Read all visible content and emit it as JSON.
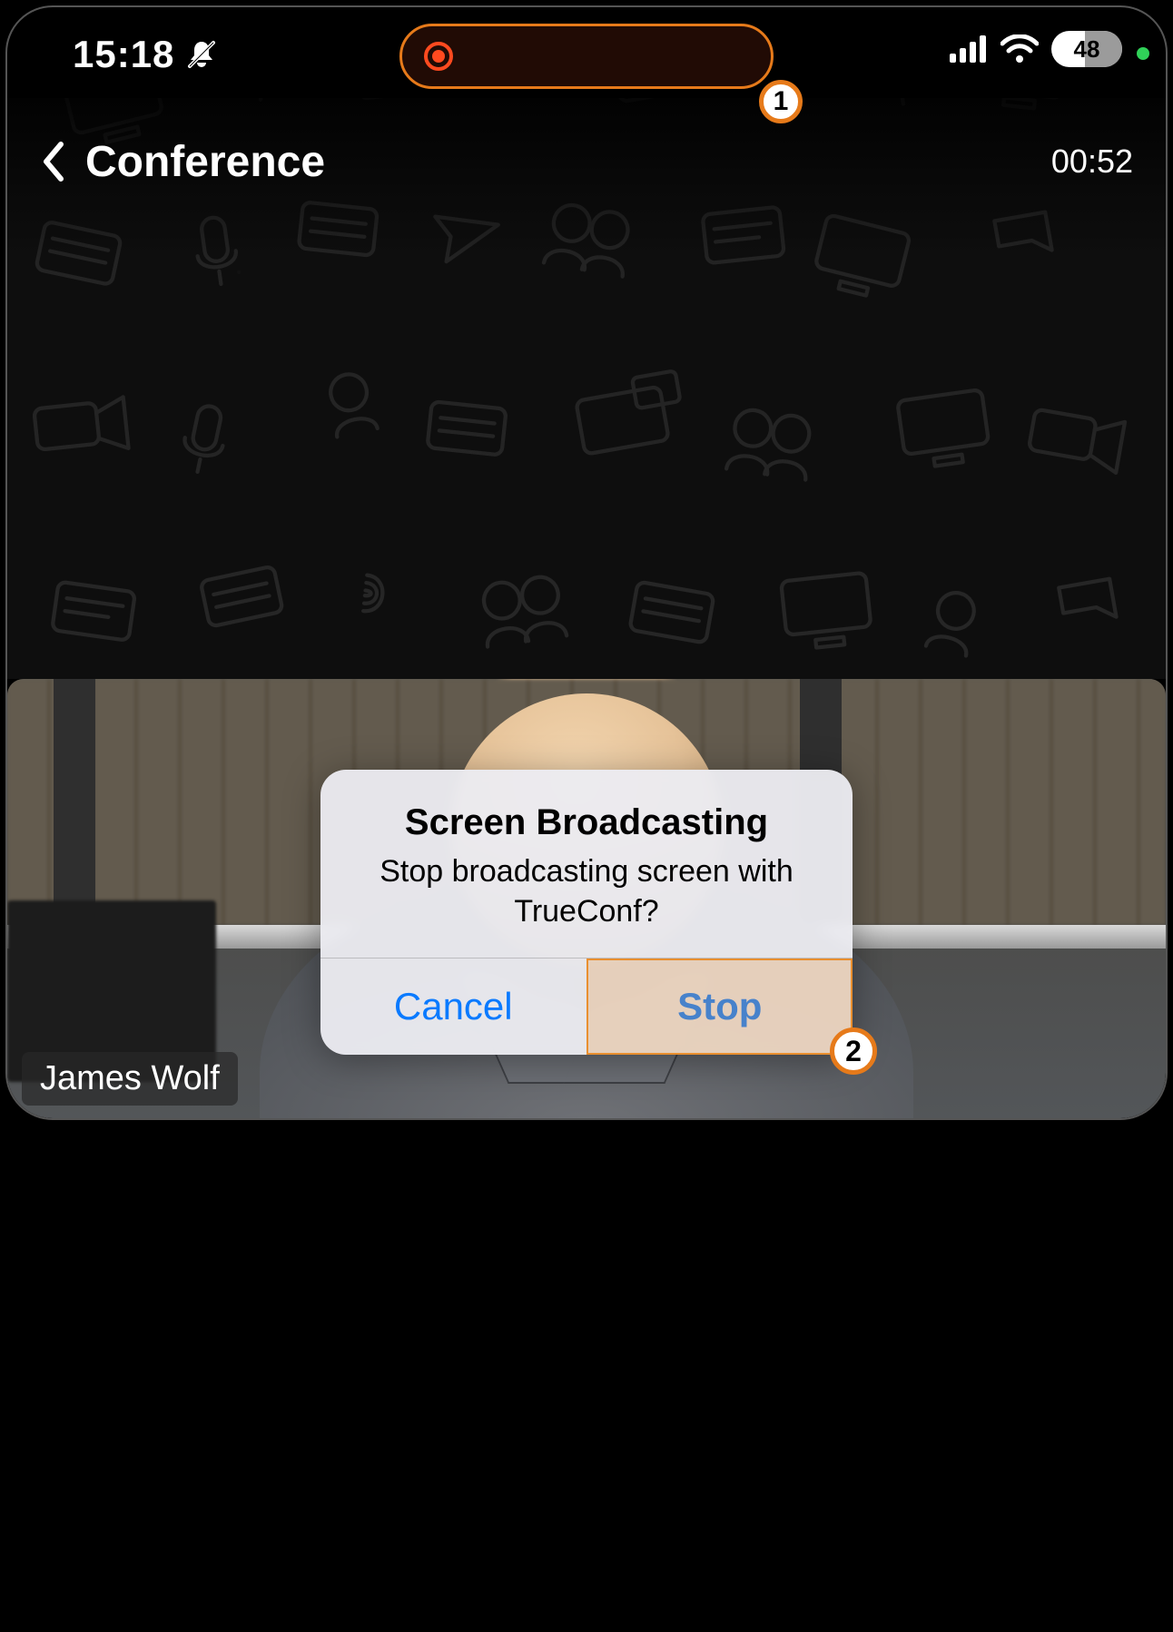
{
  "statusbar": {
    "time": "15:18",
    "battery_percent": "48"
  },
  "annotations": {
    "badge1": "1",
    "badge2": "2"
  },
  "nav": {
    "title": "Conference",
    "timer": "00:52"
  },
  "participant": {
    "name": "James Wolf"
  },
  "alert": {
    "title": "Screen Broadcasting",
    "message": "Stop broadcasting screen with TrueConf?",
    "cancel_label": "Cancel",
    "stop_label": "Stop"
  },
  "colors": {
    "accent_orange": "#e67a1a",
    "ios_blue": "#0a7aff",
    "rec_red": "#ff4a1f"
  }
}
